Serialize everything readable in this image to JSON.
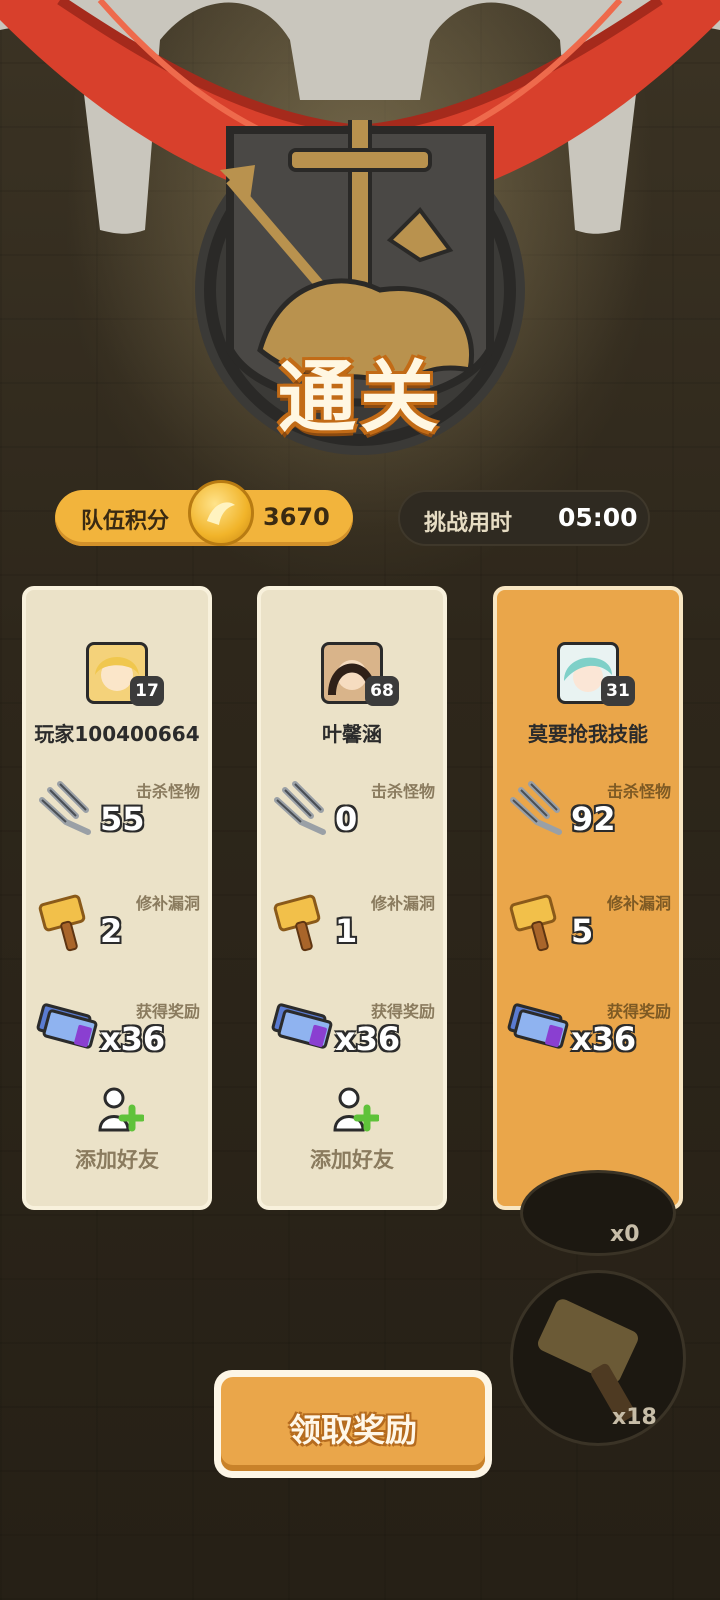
{
  "title": "通关",
  "team_score": {
    "label": "队伍积分",
    "value": "3670"
  },
  "challenge_time": {
    "label": "挑战用时",
    "value": "05:00"
  },
  "players": [
    {
      "name": "玩家100400664",
      "level": "17",
      "avatar_color": "#f4d27a",
      "highlighted": false,
      "stats": [
        {
          "label": "击杀怪物",
          "value": "55",
          "icon": "trident-icon"
        },
        {
          "label": "修补漏洞",
          "value": "2",
          "icon": "hammer-icon"
        },
        {
          "label": "获得奖励",
          "value": "x36",
          "icon": "ticket-icon"
        }
      ],
      "add_friend": "添加好友"
    },
    {
      "name": "叶馨涵",
      "level": "68",
      "avatar_color": "#6b4a36",
      "highlighted": false,
      "stats": [
        {
          "label": "击杀怪物",
          "value": "0",
          "icon": "trident-icon"
        },
        {
          "label": "修补漏洞",
          "value": "1",
          "icon": "hammer-icon"
        },
        {
          "label": "获得奖励",
          "value": "x36",
          "icon": "ticket-icon"
        }
      ],
      "add_friend": "添加好友"
    },
    {
      "name": "莫要抢我技能",
      "level": "31",
      "avatar_color": "#7fd0c8",
      "highlighted": true,
      "stats": [
        {
          "label": "击杀怪物",
          "value": "92",
          "icon": "trident-icon"
        },
        {
          "label": "修补漏洞",
          "value": "5",
          "icon": "hammer-icon"
        },
        {
          "label": "获得奖励",
          "value": "x36",
          "icon": "ticket-icon"
        }
      ]
    }
  ],
  "claim_button": "领取奖励",
  "skill_slots": [
    {
      "count": "x0"
    },
    {
      "count": "x18"
    }
  ],
  "colors": {
    "accent": "#eaa64a",
    "card": "#ebe2c8",
    "gold": "#f2b43c"
  }
}
